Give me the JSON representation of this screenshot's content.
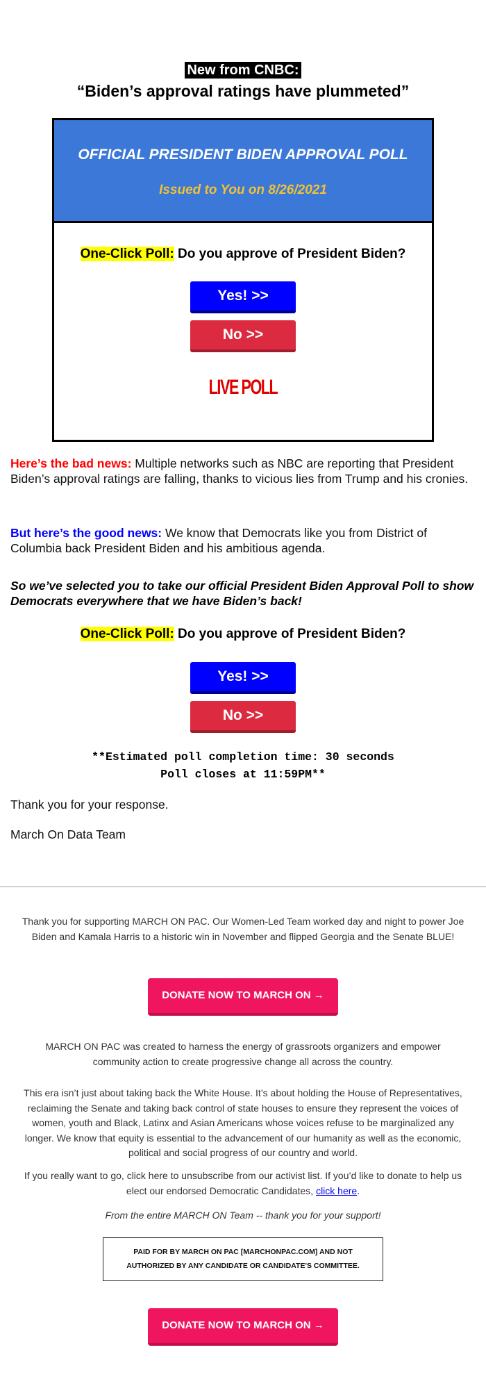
{
  "header": {
    "source_tag": "New from CNBC:",
    "headline": "“Biden’s approval ratings have plummeted”"
  },
  "poll_box": {
    "title": "OFFICIAL PRESIDENT BIDEN APPROVAL POLL",
    "issued": "Issued to You on 8/26/2021",
    "question_label": "One-Click Poll:",
    "question_text": " Do you approve of President Biden?",
    "yes_label": "Yes! >>",
    "no_label": "No >>",
    "live_poll": "LIVE POLL"
  },
  "body": {
    "bad_news_lead": "Here’s the bad news:",
    "bad_news_text": " Multiple networks such as NBC are reporting that President Biden’s approval ratings are falling, thanks to vicious lies from Trump and his cronies.",
    "good_news_lead": "But here’s the good news:",
    "good_news_text": " We know that Democrats like you from District of Columbia back President Biden and his ambitious agenda.",
    "selected_text": "So we’ve selected you to take our official President Biden Approval Poll to show Democrats everywhere that we have Biden’s back!",
    "question_label": "One-Click Poll:",
    "question_text": " Do you approve of President Biden?",
    "yes_label": "Yes! >>",
    "no_label": "No >>",
    "estimate_line1": "**Estimated poll completion time: 30 seconds",
    "estimate_line2": "Poll closes at 11:59PM**",
    "thanks": "Thank you for your response.",
    "signature": "March On Data Team"
  },
  "footer": {
    "thank_you": "Thank you for supporting MARCH ON PAC. Our Women-Led Team worked day and night to power Joe Biden and Kamala Harris to a historic win in November and flipped Georgia and the Senate BLUE!",
    "donate_label": "DONATE NOW TO MARCH ON →",
    "created": "MARCH ON PAC was created to harness the energy of grassroots organizers and empower community action to create progressive change all across the country.",
    "era": "This era isn’t just about taking back the White House. It’s about holding the House of Representatives, reclaiming the Senate and taking back control of state houses to ensure they represent the voices of women, youth and Black, Latinx and Asian Americans whose voices refuse to be marginalized any longer. We know that equity is essential to the advancement of our humanity as well as the economic, political and social progress of our country and world.",
    "unsubscribe_text": "If you really want to go, click here to unsubscribe from our activist list. If you’d like to donate to help us elect our endorsed Democratic Candidates, ",
    "click_here": "click here",
    "unsubscribe_end": ".",
    "team_thanks": "From the entire MARCH ON Team -- thank you for your support!",
    "paid_line1": "PAID FOR BY MARCH ON PAC [MARCHONPAC.COM] AND NOT",
    "paid_line2": "AUTHORIZED BY ANY CANDIDATE OR CANDIDATE'S COMMITTEE.",
    "donate_label_2": "DONATE NOW TO MARCH ON →"
  },
  "colors": {
    "poll_header_blue": "#3c78d8",
    "issued_gold": "#f1c232",
    "yes_blue": "#0000ff",
    "no_red": "#dc2a40",
    "donate_pink": "#ef155e",
    "highlight_yellow": "#ffff00"
  }
}
